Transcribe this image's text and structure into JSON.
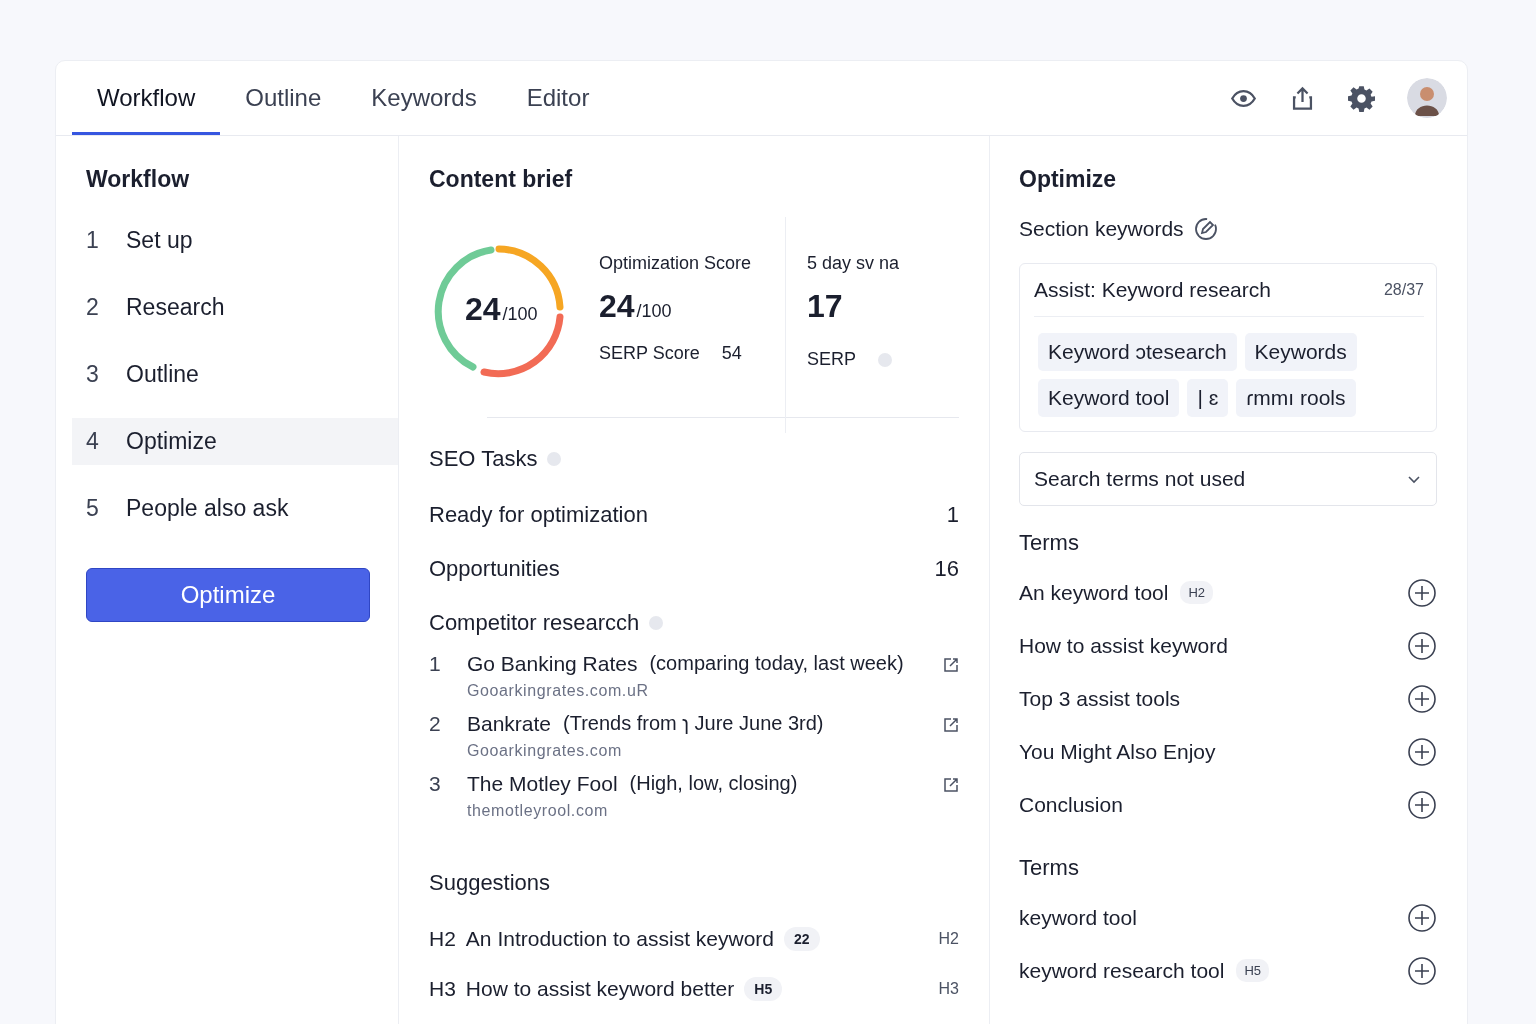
{
  "tabs": [
    {
      "label": "Workflow",
      "selected": true
    },
    {
      "label": "Outline",
      "selected": false
    },
    {
      "label": "Keywords",
      "selected": false
    },
    {
      "label": "Editor",
      "selected": false
    }
  ],
  "workflow": {
    "title": "Workflow",
    "steps": [
      {
        "number": "1",
        "label": "Set up",
        "selected": false
      },
      {
        "number": "2",
        "label": "Research",
        "selected": false
      },
      {
        "number": "3",
        "label": "Outline",
        "selected": false
      },
      {
        "number": "4",
        "label": "Optimize",
        "selected": true
      },
      {
        "number": "5",
        "label": "People also ask",
        "selected": false
      }
    ],
    "button": "Optimize"
  },
  "brief": {
    "title": "Content brief",
    "ring": {
      "value": "24",
      "max": "/100"
    },
    "optimization": {
      "label": "Optimization Score",
      "value": "24",
      "max": "/100"
    },
    "serp_score": {
      "label": "SERP Score",
      "value": "54"
    },
    "sv": {
      "label": "5 day sv na",
      "value": "17",
      "serp_label": "SERP"
    },
    "seo_tasks": {
      "title": "SEO Tasks",
      "rows": [
        {
          "label": "Ready for optimization",
          "count": "1"
        },
        {
          "label": "Opportunities",
          "count": "16"
        }
      ]
    },
    "competitors": {
      "title": "Competitor researcch",
      "items": [
        {
          "number": "1",
          "name": "Go Banking Rates",
          "note": "(comparing today, last week)",
          "url": "Gooarkingrates.com.uR"
        },
        {
          "number": "2",
          "name": "Bankrate",
          "note": "(Trends from ɿ Jure June 3rd)",
          "url": "Gooarkingrates.com"
        },
        {
          "number": "3",
          "name": "The Motley Fool",
          "note": "(High,   low, closing)",
          "url": "themotleyrool.com"
        }
      ]
    },
    "suggestions": {
      "title": "Suggestions",
      "items": [
        {
          "level": "H2",
          "text": "An Introduction to assist keyword",
          "badge": "22",
          "tag": "H2"
        },
        {
          "level": "H3",
          "text": "How to assist keyword better",
          "badge": "H5",
          "tag": "H3"
        }
      ]
    }
  },
  "optimize": {
    "title": "Optimize",
    "section_keywords": "Section keywords",
    "assist": {
      "title": "Assist: Keyword research",
      "count": "28/37",
      "chips": [
        "Keyword ɔtesearch",
        "Keywords",
        "Keyword tool",
        "| ɛ",
        "ɾmmı rools"
      ]
    },
    "dropdown": "Search terms not used",
    "term_groups": [
      {
        "title": "Terms",
        "items": [
          {
            "label": "An keyword tool",
            "badge": "H2"
          },
          {
            "label": "How to assist keyword"
          },
          {
            "label": "Top 3 assist tools"
          },
          {
            "label": "You Might Also Enjoy"
          },
          {
            "label": "Conclusion"
          }
        ]
      },
      {
        "title": "Terms",
        "items": [
          {
            "label": "keyword tool"
          },
          {
            "label": "keyword research tool",
            "badge": "H5"
          }
        ]
      }
    ]
  }
}
